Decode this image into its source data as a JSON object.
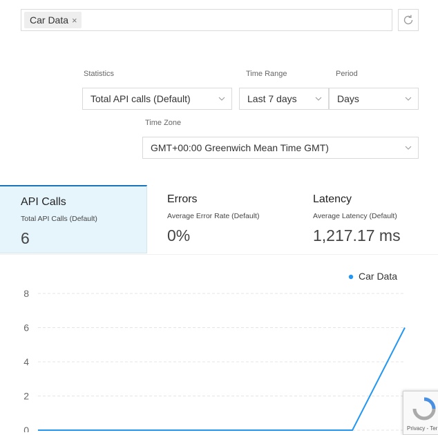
{
  "filter": {
    "chip_label": "Car Data",
    "chip_remove": "×"
  },
  "controls": {
    "statistics": {
      "label": "Statistics",
      "value": "Total API calls (Default)"
    },
    "time_range": {
      "label": "Time Range",
      "value": "Last 7 days"
    },
    "period": {
      "label": "Period",
      "value": "Days"
    },
    "time_zone": {
      "label": "Time Zone",
      "value": "GMT+00:00 Greenwich Mean Time GMT)"
    }
  },
  "tabs": [
    {
      "title": "API Calls",
      "subtitle": "Total API Calls (Default)",
      "value": "6",
      "active": true
    },
    {
      "title": "Errors",
      "subtitle": "Average Error Rate (Default)",
      "value": "0%",
      "active": false
    },
    {
      "title": "Latency",
      "subtitle": "Average Latency (Default)",
      "value": "1,217.17 ms",
      "active": false
    }
  ],
  "colors": {
    "accent": "#2196f3",
    "active_tab_bg": "#e6f5fc",
    "active_tab_border": "#1a73b8"
  },
  "recaptcha": {
    "text": "Privacy - Ter"
  },
  "chart_data": {
    "type": "line",
    "series": [
      {
        "name": "Car Data",
        "values": [
          0,
          0,
          0,
          0,
          0,
          0,
          0,
          6
        ]
      }
    ],
    "ylim": [
      0,
      8
    ],
    "yticks": [
      "0",
      "2",
      "4",
      "6",
      "8"
    ],
    "grid": true,
    "legend_position": "top-right"
  }
}
